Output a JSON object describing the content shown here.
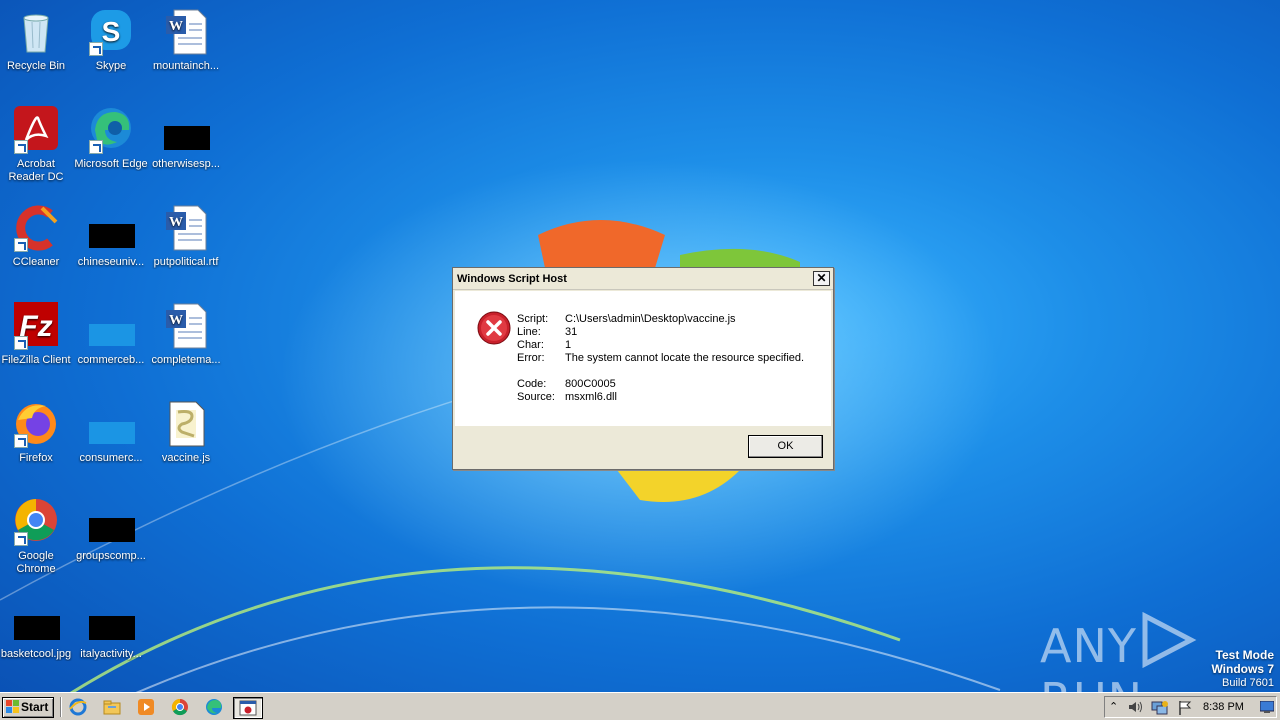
{
  "desktop": {
    "icons": [
      {
        "label": "Recycle Bin"
      },
      {
        "label": "Skype"
      },
      {
        "label": "mountainch..."
      },
      {
        "label": "Acrobat Reader DC"
      },
      {
        "label": "Microsoft Edge"
      },
      {
        "label": "otherwisesp..."
      },
      {
        "label": "CCleaner"
      },
      {
        "label": "chineseuniv..."
      },
      {
        "label": "putpolitical.rtf"
      },
      {
        "label": "FileZilla Client"
      },
      {
        "label": "commerceb..."
      },
      {
        "label": "completema..."
      },
      {
        "label": "Firefox"
      },
      {
        "label": "consumerc..."
      },
      {
        "label": "vaccine.js"
      },
      {
        "label": "Google Chrome"
      },
      {
        "label": "groupscomp..."
      },
      {
        "label": "basketcool.jpg"
      },
      {
        "label": "italyactivity..."
      }
    ]
  },
  "dialog": {
    "title": "Windows Script Host",
    "close_label": "✕",
    "fields": [
      {
        "key": "Script:",
        "value": "C:\\Users\\admin\\Desktop\\vaccine.js"
      },
      {
        "key": "Line:",
        "value": "31"
      },
      {
        "key": "Char:",
        "value": "1"
      },
      {
        "key": "Error:",
        "value": "The system cannot locate the resource specified."
      },
      {
        "key": "Code:",
        "value": "800C0005"
      },
      {
        "key": "Source:",
        "value": "msxml6.dll"
      }
    ],
    "ok_label": "OK",
    "icon": "error-icon"
  },
  "watermark": {
    "brand_left": "ANY",
    "brand_right": "RUN",
    "line1": "Test Mode",
    "line2": "Windows 7",
    "line3": "Build 7601"
  },
  "taskbar": {
    "start_label": "Start",
    "clock": "8:38 PM",
    "pinned": [
      "ie-icon",
      "explorer-icon",
      "media-player-icon",
      "chrome-icon",
      "edge-icon"
    ],
    "tray_icons": [
      "show-hidden-icons-chevron",
      "volume-icon",
      "network-icon",
      "action-center-flag-icon",
      "show-desktop-icon"
    ]
  },
  "colors": {
    "desktop_blue": "#1d8ee8",
    "dialog_bg": "#ece9d8",
    "error_red": "#c8202b",
    "taskbar": "#d4d0c8"
  }
}
